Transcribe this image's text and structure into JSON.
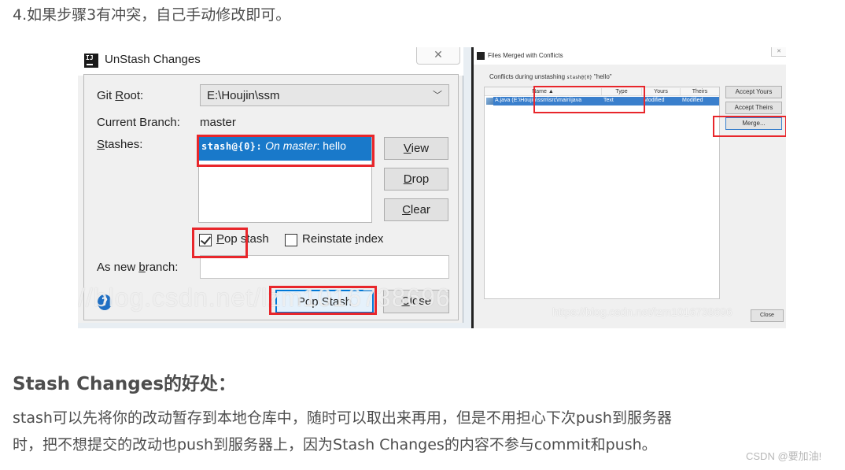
{
  "article": {
    "step_text": "4.如果步骤3有冲突，自己手动修改即可。",
    "section_heading": "Stash Changes的好处：",
    "paragraph_line1": "stash可以先将你的改动暂存到本地仓库中，随时可以取出来再用，但是不用担心下次push到服务器",
    "paragraph_line2": "时，把不想提交的改动也push到服务器上，因为Stash Changes的内容不参与commit和push。",
    "csdn_watermark": "CSDN @要加油!"
  },
  "unstash_dialog": {
    "title": "UnStash Changes",
    "logo_text": "IJ",
    "close_glyph": "✕",
    "git_root_label_pre": "Git ",
    "git_root_label_mnemonic": "R",
    "git_root_label_post": "oot:",
    "git_root_value": "E:\\Houjin\\ssm",
    "dropdown_glyph": "﹀",
    "current_branch_label": "Current Branch:",
    "current_branch_value": "master",
    "stashes_label_mnemonic": "S",
    "stashes_label_post": "tashes:",
    "stashes": [
      {
        "id": "stash@{0}:",
        "on": " On master",
        "message": ": hello"
      }
    ],
    "view_button": {
      "mnemonic": "V",
      "rest": "iew"
    },
    "drop_button": {
      "mnemonic": "D",
      "rest": "rop"
    },
    "clear_button": {
      "mnemonic": "C",
      "rest": "lear"
    },
    "pop_stash_checkbox": {
      "mnemonic": "P",
      "rest": "op stash",
      "checked": true
    },
    "reinstate_index_checkbox": {
      "pre": "Reinstate ",
      "mnemonic": "i",
      "rest": "ndex",
      "checked": false
    },
    "new_branch_label_pre": "As new ",
    "new_branch_label_mnemonic": "b",
    "new_branch_label_post": "ranch:",
    "new_branch_value": "",
    "help_glyph": "?",
    "pop_stash_button": "Pop Stash",
    "close_button": {
      "mnemonic": "C",
      "rest": "lose"
    },
    "watermark": "//blog.csdn.net/lzm1016738696"
  },
  "conflicts_dialog": {
    "title": "Files Merged with Conflicts",
    "close_glyph": "✕",
    "caption_pre": "Conflicts during unstashing ",
    "caption_stash": "stash@{0}",
    "caption_msg": " \"hello\"",
    "columns": [
      "Name ▲",
      "Type",
      "Yours",
      "Theirs"
    ],
    "rows": [
      {
        "name": "A.java (E:\\Houjin\\ssm\\src\\main\\java",
        "type": "Text",
        "yours": "Modified",
        "theirs": "Modified"
      }
    ],
    "accept_yours_button": "Accept Yours",
    "accept_theirs_button": "Accept Theirs",
    "merge_button": "Merge...",
    "close_button": "Close",
    "watermark": "https://blog.csdn.net/lzm1016738696"
  },
  "colors": {
    "highlight_red": "#e8262b",
    "selection_blue": "#1979ca",
    "text_gray": "#4d4d4d"
  }
}
